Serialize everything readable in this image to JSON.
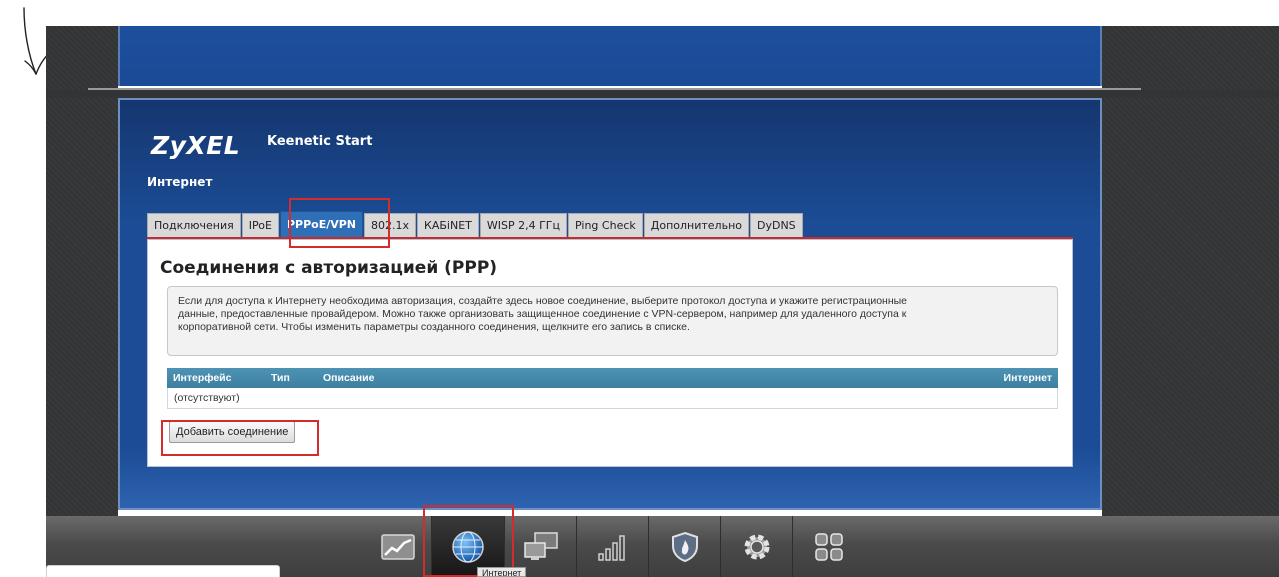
{
  "brand": {
    "logo": "ZyXEL",
    "model": "Keenetic Start"
  },
  "section_title": "Интернет",
  "tabs": [
    {
      "label": "Подключения",
      "active": false
    },
    {
      "label": "IPoE",
      "active": false
    },
    {
      "label": "PPPoE/VPN",
      "active": true
    },
    {
      "label": "802.1x",
      "active": false
    },
    {
      "label": "КАБiNET",
      "active": false
    },
    {
      "label": "WISP 2,4 ГГц",
      "active": false
    },
    {
      "label": "Ping Check",
      "active": false
    },
    {
      "label": "Дополнительно",
      "active": false
    },
    {
      "label": "DyDNS",
      "active": false
    }
  ],
  "content": {
    "heading": "Соединения с авторизацией (PPP)",
    "info_line1": "Если для доступа к Интернету необходима авторизация, создайте здесь новое соединение, выберите протокол доступа и укажите регистрационные",
    "info_line2": "данные, предоставленные провайдером. Можно также организовать защищенное соединение с VPN-сервером, например для удаленного доступа к",
    "info_line3": "корпоративной сети. Чтобы изменить параметры созданного соединения, щелкните его запись в списке.",
    "table": {
      "columns": [
        "Интерфейс",
        "Тип",
        "Описание",
        "Интернет"
      ],
      "empty_row": "(отсутствуют)"
    },
    "add_button": "Добавить соединение"
  },
  "taskbar": {
    "items": [
      {
        "icon": "chart-icon"
      },
      {
        "icon": "globe-icon",
        "active": true
      },
      {
        "icon": "network-icon"
      },
      {
        "icon": "signal-bars-icon"
      },
      {
        "icon": "shield-icon"
      },
      {
        "icon": "gear-icon"
      },
      {
        "icon": "apps-grid-icon"
      }
    ],
    "tooltip": "Интернет"
  },
  "colors": {
    "panel_blue": "#1b4c95",
    "active_tab": "#2f6fb8",
    "highlight_red": "#d42b2b",
    "table_header": "#4e93b4"
  }
}
